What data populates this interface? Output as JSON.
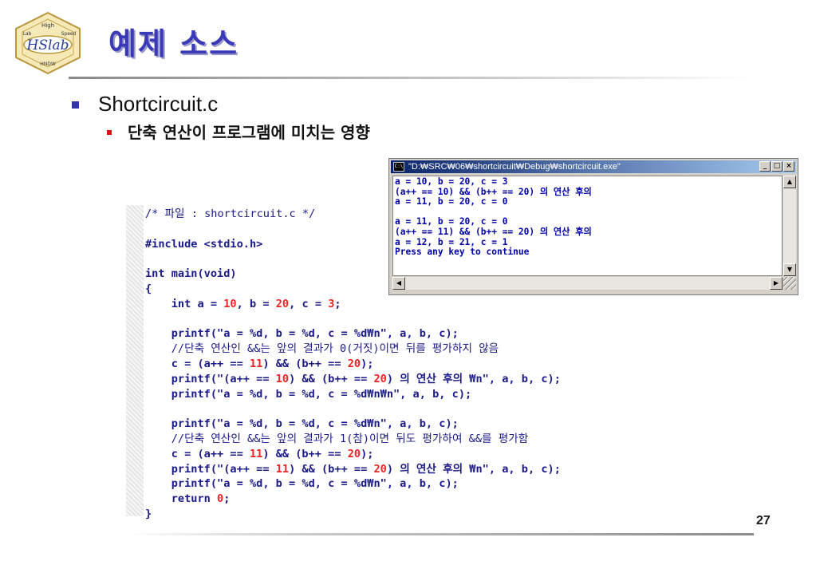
{
  "logo": {
    "text": "HSlab",
    "motto_top": "High",
    "motto_right": "Speed",
    "motto_left": "Lab",
    "motto_bottom": "HNDW"
  },
  "slide": {
    "title": "예제 소스",
    "bullet1": "Shortcircuit.c",
    "bullet2": "단축 연산이 프로그램에 미치는 영향",
    "page_number": "27"
  },
  "code": {
    "lines": [
      "/* 파일 : shortcircuit.c */",
      "",
      "#include <stdio.h>",
      "",
      "int main(void)",
      "{",
      "    int a = 10, b = 20, c = 3;",
      "",
      "    printf(\"a = %d, b = %d, c = %d₩n\", a, b, c);",
      "    //단축 연산인 &&는 앞의 결과가 0(거짓)이면 뒤를 평가하지 않음",
      "    c = (a++ == 11) && (b++ == 20);",
      "    printf(\"(a++ == 10) && (b++ == 20) 의 연산 후의 ₩n\", a, b, c);",
      "    printf(\"a = %d, b = %d, c = %d₩n₩n\", a, b, c);",
      "",
      "    printf(\"a = %d, b = %d, c = %d₩n\", a, b, c);",
      "    //단축 연산인 &&는 앞의 결과가 1(참)이면 뒤도 평가하여 &&를 평가함",
      "    c = (a++ == 11) && (b++ == 20);",
      "    printf(\"(a++ == 11) && (b++ == 20) 의 연산 후의 ₩n\", a, b, c);",
      "    printf(\"a = %d, b = %d, c = %d₩n\", a, b, c);",
      "    return 0;",
      "}"
    ]
  },
  "console": {
    "title": "\"D:₩SRC₩06₩shortcircuit₩Debug₩shortcircuit.exe\"",
    "icon_label": "C:\\",
    "buttons": {
      "minimize": "_",
      "maximize": "□",
      "close": "×"
    },
    "lines": [
      "a = 10, b = 20, c = 3",
      "(a++ == 10) && (b++ == 20) 의 연산 후의",
      "a = 11, b = 20, c = 0",
      "",
      "a = 11, b = 20, c = 0",
      "(a++ == 11) && (b++ == 20) 의 연산 후의",
      "a = 12, b = 21, c = 1",
      "Press any key to continue"
    ],
    "scroll": {
      "up": "▲",
      "down": "▼",
      "left": "◀",
      "right": "▶"
    }
  },
  "colors": {
    "title": "#3a3ab8",
    "code": "#1a1a88",
    "number": "#ee2222",
    "console_text": "#0000aa",
    "titlebar": "#0a246a"
  }
}
